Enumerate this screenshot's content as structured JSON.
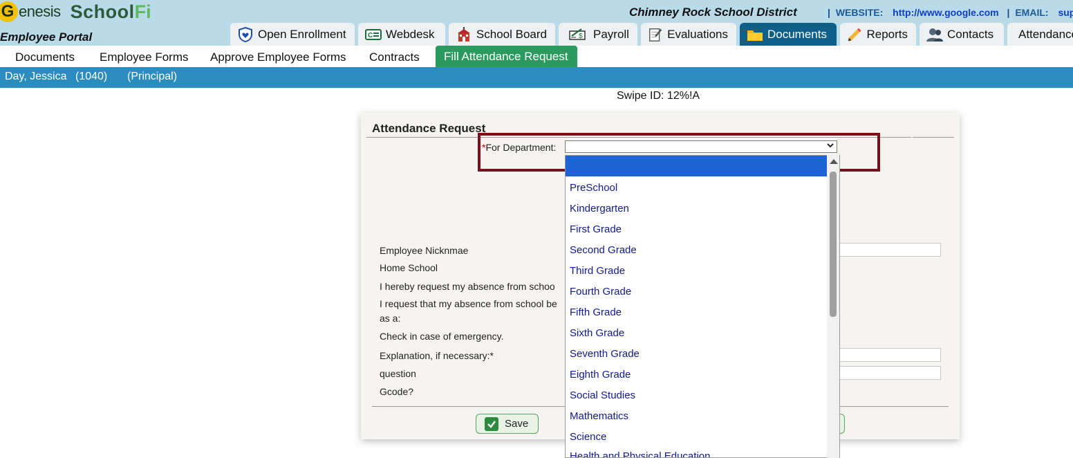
{
  "brand": {
    "logo_letter": "G",
    "logo_text": "enesis",
    "school": "School",
    "fi": "Fi",
    "portal": "Employee Portal"
  },
  "header": {
    "district": "Chimney Rock School District",
    "website_label": "WEBSITE:",
    "website_value": "http://www.google.com",
    "email_label": "EMAIL:",
    "email_value": "sup"
  },
  "top_tabs": [
    {
      "label": "Open Enrollment",
      "icon": "shield-heart-icon"
    },
    {
      "label": "Webdesk",
      "icon": "webdesk-icon"
    },
    {
      "label": "School Board",
      "icon": "schoolhouse-icon"
    },
    {
      "label": "Payroll",
      "icon": "check-payment-icon"
    },
    {
      "label": "Evaluations",
      "icon": "notepad-pencil-icon"
    },
    {
      "label": "Documents",
      "icon": "folder-icon",
      "active": true
    },
    {
      "label": "Reports",
      "icon": "pencil-icon"
    },
    {
      "label": "Contacts",
      "icon": "people-icon"
    },
    {
      "label": "Attendance",
      "icon": "calendar-icon"
    }
  ],
  "sub_nav": [
    {
      "label": "Documents"
    },
    {
      "label": "Employee Forms"
    },
    {
      "label": "Approve Employee Forms"
    },
    {
      "label": "Contracts"
    },
    {
      "label": "Fill Attendance Request",
      "active": true
    }
  ],
  "person": {
    "name": "Day, Jessica",
    "id": "(1040)",
    "role": "(Principal)"
  },
  "swipe": "Swipe ID: 12%!A",
  "form": {
    "title": "Attendance Request",
    "dept_required_mark": "*",
    "dept_label": "For Department:",
    "rows": [
      "Employee Nicknmae",
      "Home School",
      "I hereby request my absence from schoo",
      "I request that my absence from school be",
      "as a:",
      "Check in case of emergency.",
      "Explanation, if necessary:*",
      "question",
      "Gcode?"
    ],
    "save_label": "Save"
  },
  "dropdown_options": [
    "PreSchool",
    "Kindergarten",
    "First Grade",
    "Second Grade",
    "Third Grade",
    "Fourth Grade",
    "Fifth Grade",
    "Sixth Grade",
    "Seventh Grade",
    "Eighth Grade",
    "Social Studies",
    "Mathematics",
    "Science",
    "Health and Physical Education"
  ],
  "colors": {
    "active_tab": "#0e5f8a",
    "active_subnav": "#2b9a5e",
    "person_bar": "#2a8cbf",
    "highlight": "#7a0f1c",
    "option_text": "#101a8f"
  }
}
